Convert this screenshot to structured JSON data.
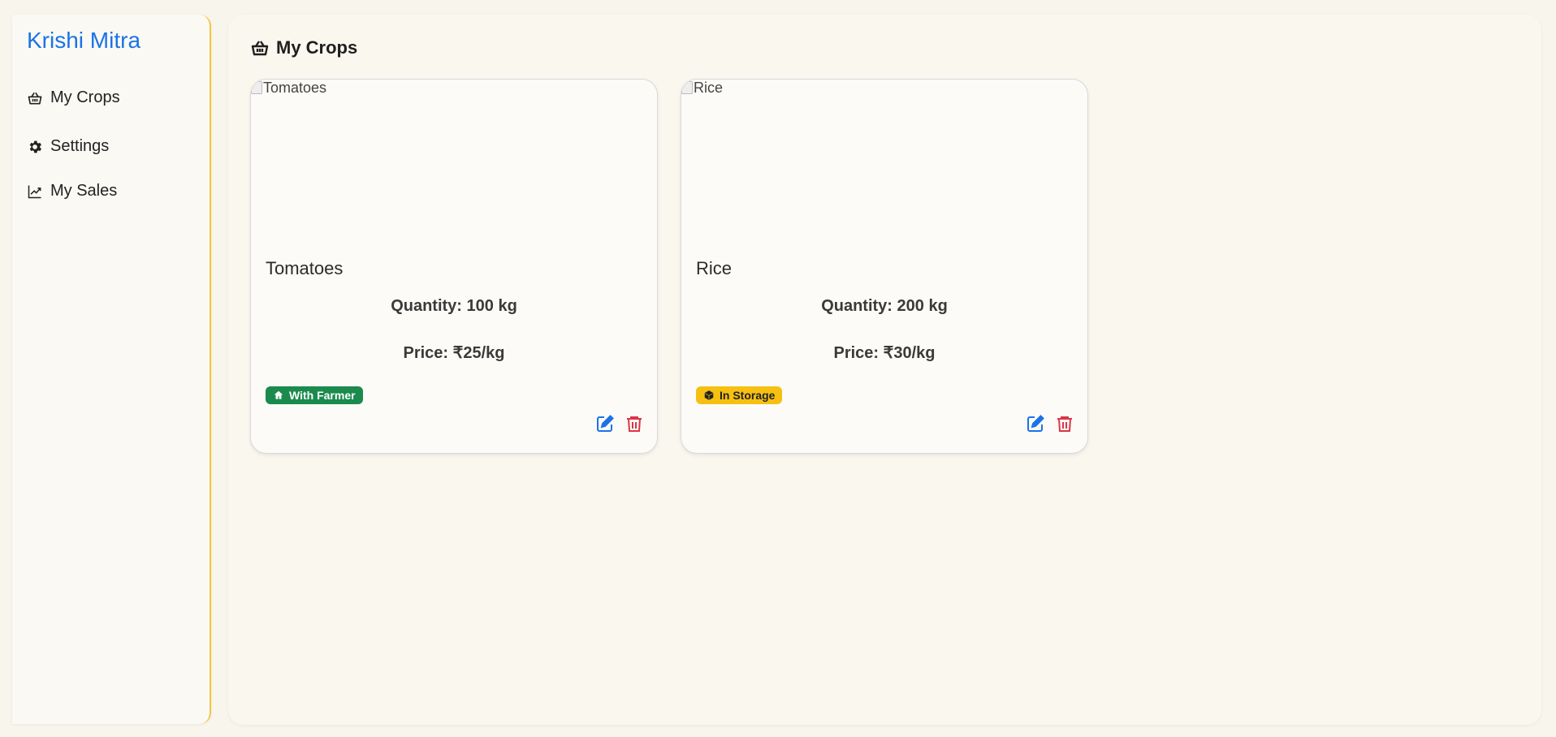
{
  "sidebar": {
    "brand": "Krishi Mitra",
    "items": [
      {
        "label": "My Crops",
        "icon": "basket-icon"
      },
      {
        "label": "Settings",
        "icon": "gear-icon"
      },
      {
        "label": "My Sales",
        "icon": "trend-chart-icon"
      }
    ]
  },
  "main": {
    "title": "My Crops",
    "title_icon": "basket-icon",
    "crops": [
      {
        "image_alt": "Tomatoes",
        "name": "Tomatoes",
        "quantity": "Quantity: 100 kg",
        "price": "Price: ₹25/kg",
        "status": "With Farmer",
        "status_icon": "home-icon",
        "status_color": "#1b8a4d"
      },
      {
        "image_alt": "Rice",
        "name": "Rice",
        "quantity": "Quantity: 200 kg",
        "price": "Price: ₹30/kg",
        "status": "In Storage",
        "status_icon": "box-icon",
        "status_color": "#f6c012"
      }
    ]
  },
  "colors": {
    "brand": "#1a73e8",
    "accent_border": "#f4c542",
    "edit": "#1a73e8",
    "delete": "#dc3545"
  }
}
